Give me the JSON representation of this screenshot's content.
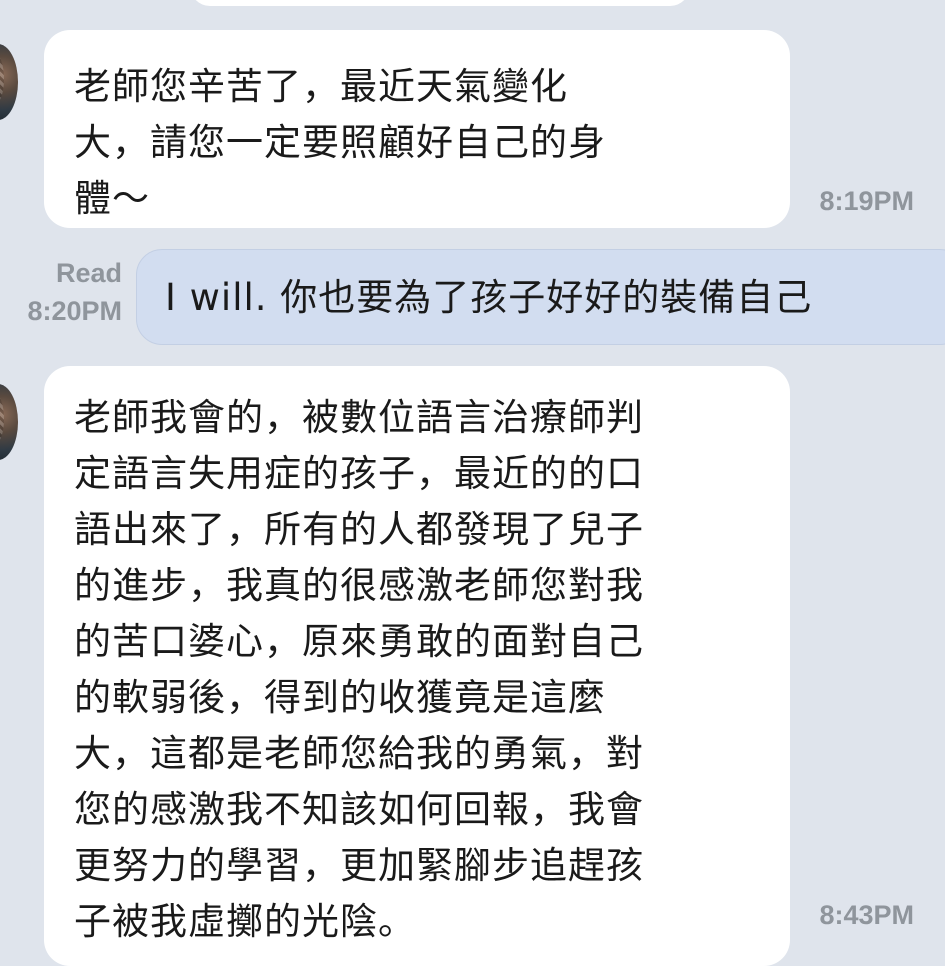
{
  "messages": [
    {
      "direction": "incoming",
      "lines": [
        "老師您辛苦了，最近天氣變化",
        "大，請您一定要照顧好自己的身",
        "體～"
      ],
      "time": "8:19PM"
    },
    {
      "direction": "outgoing",
      "text": "I will.  你也要為了孩子好好的裝備自己",
      "read_label": "Read",
      "time": "8:20PM"
    },
    {
      "direction": "incoming",
      "lines": [
        "老師我會的，被數位語言治療師判",
        "定語言失用症的孩子，最近的的口",
        "語出來了，所有的人都發現了兒子",
        "的進步，我真的很感激老師您對我",
        "的苦口婆心，原來勇敢的面對自己",
        "的軟弱後，得到的收獲竟是這麼",
        "大，這都是老師您給我的勇氣，對",
        "您的感激我不知該如何回報，我會",
        "更努力的學習，更加緊腳步追趕孩",
        "子被我虛擲的光陰。"
      ],
      "time": "8:43PM"
    }
  ],
  "colors": {
    "background": "#dfe4ec",
    "incoming_bubble": "#ffffff",
    "outgoing_bubble": "#d2ddf0",
    "meta_text": "#8f959c"
  }
}
